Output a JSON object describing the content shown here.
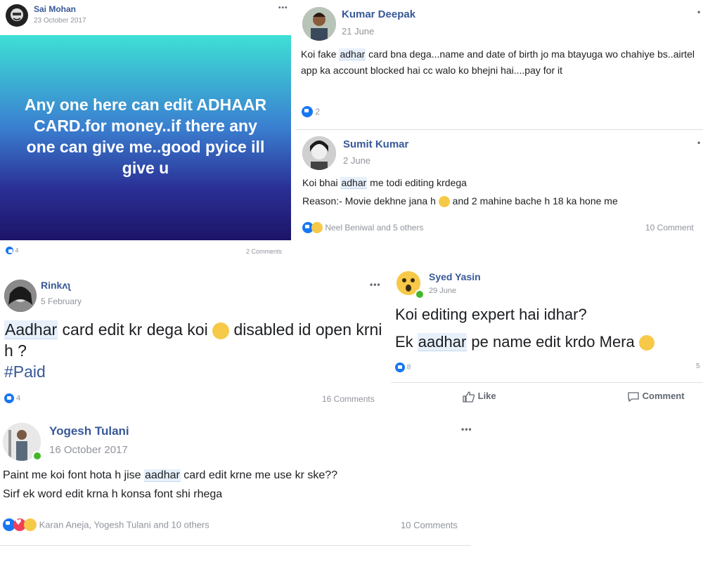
{
  "posts": [
    {
      "author": "Sai Mohan",
      "date": "23 October 2017",
      "text": "Any one here can edit ADHAAR CARD.for money..if there any one can give me..good pyice ill give u",
      "reactions_count": "4",
      "comments": "2 Comments"
    },
    {
      "author": "Kumar Deepak",
      "date": "21 June",
      "text_parts": [
        "Koi fake ",
        "adhar",
        " card bna dega...name and date of birth jo ma btayuga wo chahiye bs..airtel app ka account blocked hai cc walo ko bhejni hai....pay for it"
      ],
      "reactions_count": "2"
    },
    {
      "author": "Sumit Kumar",
      "date": "2 June",
      "line1_parts": [
        "Koi bhai ",
        "adhar",
        " me todi editing krdega"
      ],
      "line2_a": "Reason:- Movie dekhne jana h ",
      "line2_b": " and 2 mahine bache h 18 ka hone me",
      "reactions_text": "Neel Beniwal and 5 others",
      "comments": "10 Comment"
    },
    {
      "author": "Rinkʌʅ",
      "date": "5 February",
      "line1_parts": [
        "Aadhar",
        " card edit kr dega koi "
      ],
      "line1_after": " disabled id open krni h ?",
      "hashtag": "#Paid",
      "reactions_count": "4",
      "comments": "16 Comments"
    },
    {
      "author": "Syed Yasin",
      "date": "29 June",
      "line1": "Koi editing expert hai idhar?",
      "line2_parts": [
        "Ek ",
        "aadhar",
        " pe name edit krdo Mera "
      ],
      "reactions_count": "8",
      "comments_short": "5",
      "like_label": "Like",
      "comment_label": "Comment"
    },
    {
      "author": "Yogesh Tulani",
      "date": "16 October 2017",
      "line1_parts": [
        "Paint me koi font hota h jise ",
        "aadhar",
        " card edit krne me use kr ske??"
      ],
      "line2": "Sirf ek word edit krna h konsa font shi rhega",
      "reactions_text": "Karan Aneja, Yogesh Tulani and 10 others",
      "comments": "10 Comments"
    }
  ],
  "menu_glyph": "•••",
  "colors": {
    "link_blue": "#385898",
    "like_blue": "#1877f2",
    "gradient_top": "#3ee0d5",
    "gradient_bottom": "#1c1468"
  }
}
